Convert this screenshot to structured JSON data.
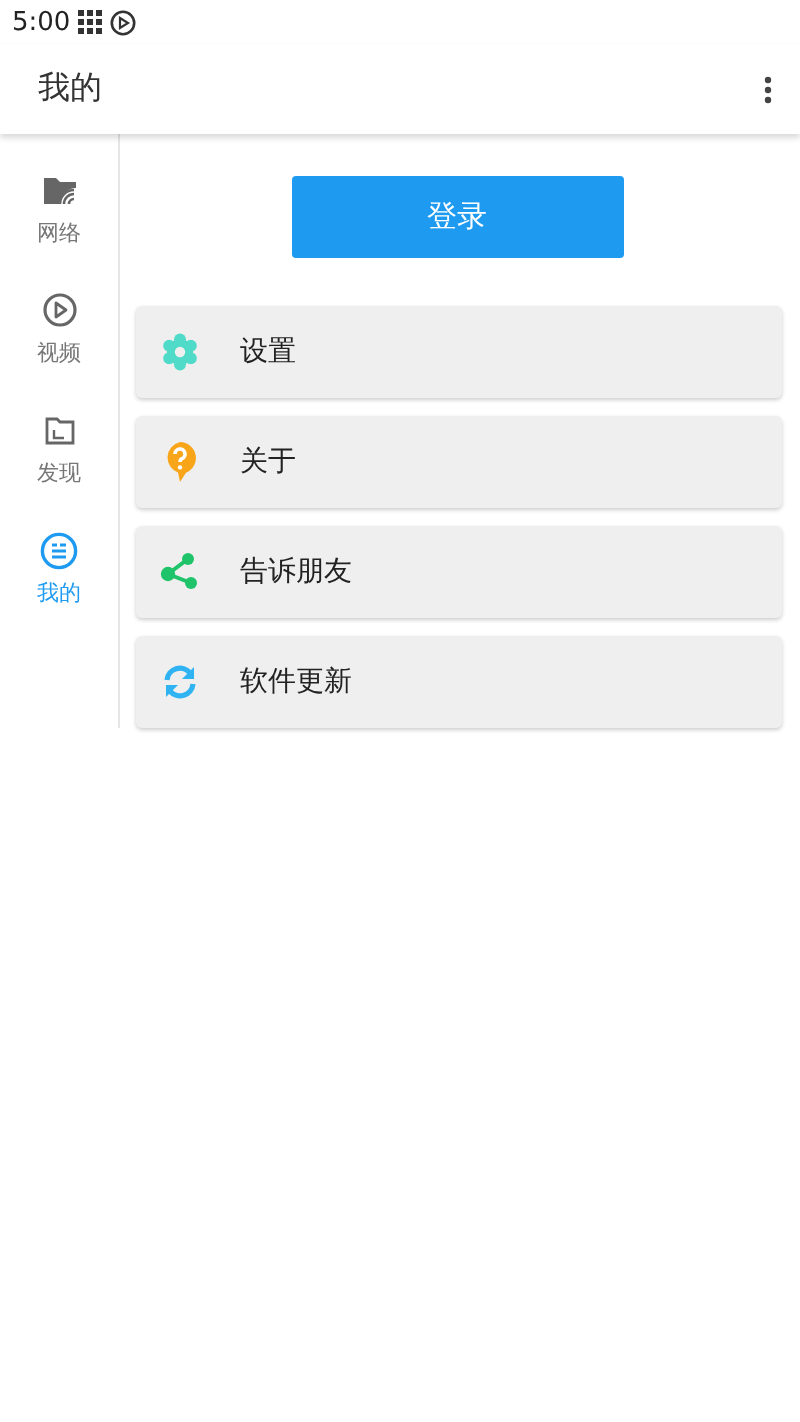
{
  "status_bar": {
    "time": "5:00"
  },
  "app_bar": {
    "title": "我的"
  },
  "sidebar": {
    "items": [
      {
        "label": "网络",
        "kind": "network",
        "selected": false
      },
      {
        "label": "视频",
        "kind": "video",
        "selected": false
      },
      {
        "label": "发现",
        "kind": "discover",
        "selected": false
      },
      {
        "label": "我的",
        "kind": "mine",
        "selected": true
      }
    ]
  },
  "login_button": {
    "label": "登录"
  },
  "menu": [
    {
      "label": "设置",
      "kind": "settings"
    },
    {
      "label": "关于",
      "kind": "about"
    },
    {
      "label": "告诉朋友",
      "kind": "share"
    },
    {
      "label": "软件更新",
      "kind": "update"
    }
  ]
}
